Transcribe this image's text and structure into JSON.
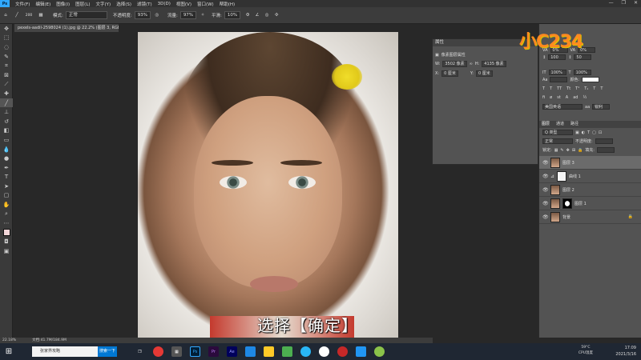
{
  "menubar": {
    "logo": "Ps",
    "items": [
      "文件(F)",
      "编辑(E)",
      "图像(I)",
      "图层(L)",
      "文字(Y)",
      "选择(S)",
      "滤镜(T)",
      "3D(D)",
      "视图(V)",
      "窗口(W)",
      "帮助(H)"
    ],
    "controls": [
      "—",
      "❐",
      "✕"
    ]
  },
  "options": {
    "size": "200",
    "mode_label": "模式:",
    "mode": "正常",
    "opacity_label": "不透明度:",
    "opacity": "93%",
    "flow_label": "流量:",
    "flow": "97%",
    "smooth_label": "平滑:",
    "smooth": "10%"
  },
  "document": {
    "tab": "pexels-aadil-2598024 (1).jpg @ 22.2% (图层 3, RGB/8) *"
  },
  "subtitle": "选择【确定】",
  "properties": {
    "title": "属性",
    "section": "像素图层属性",
    "w_label": "W:",
    "w": "3502 像素",
    "h_label": "H:",
    "h": "4135 像素",
    "x_label": "X:",
    "x": "0 厘米",
    "y_label": "Y:",
    "y": "0 厘米"
  },
  "right_controls": {
    "r1a": "0%",
    "r1b": "0%",
    "r2a": "100",
    "r2b": "50",
    "r3": "100%",
    "r4": "100%",
    "blend": "美国英语",
    "aa": "锐利",
    "color_label": "颜色:"
  },
  "layers_panel": {
    "tabs": [
      "图层",
      "通道",
      "路径"
    ],
    "search_placeholder": "Q 类型",
    "blend": "正常",
    "opacity_label": "不透明度:",
    "fill_label": "填充:",
    "lock_label": "锁定:",
    "layers": [
      {
        "name": "图层 3",
        "selected": true
      },
      {
        "name": "曲线 1",
        "selected": false
      },
      {
        "name": "图层 2",
        "selected": false
      },
      {
        "name": "图层 1",
        "selected": false
      },
      {
        "name": "背景",
        "selected": false
      }
    ]
  },
  "status": {
    "zoom": "22.18%",
    "doc": "文档:41.7M/184.9M"
  },
  "logo": "小C234",
  "taskbar": {
    "search": "张家界攻略",
    "search_btn": "搜索一下",
    "tray": [
      "59°C",
      "CPU温度"
    ],
    "time": "17:09",
    "date": "2021/3/16"
  },
  "colors": {
    "ps_blue": "#31a8ff",
    "accent": "#ff8a1f",
    "taskbar": "#1f2733"
  }
}
